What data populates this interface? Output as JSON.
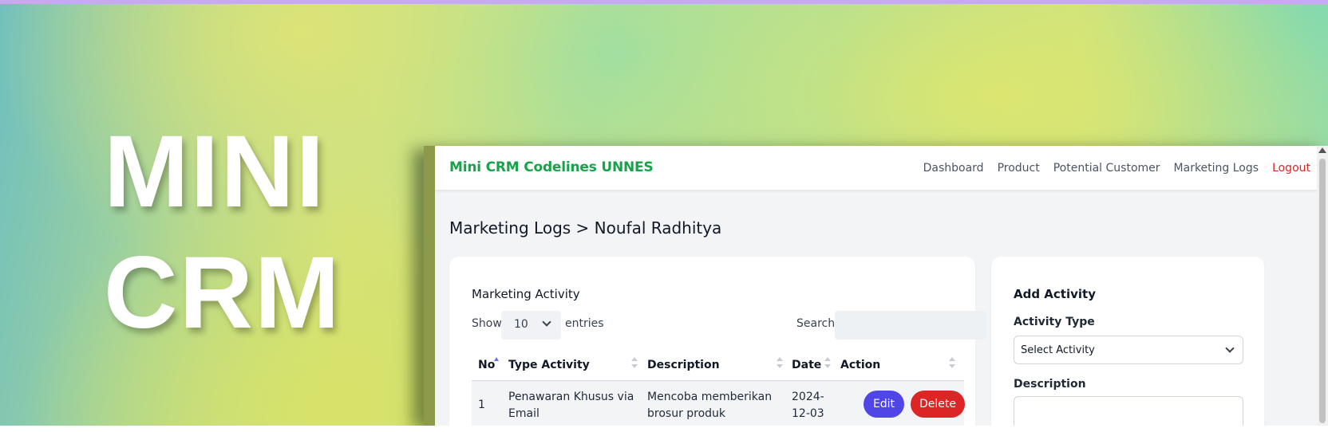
{
  "hero": {
    "line1": "MINI",
    "line2": "CRM"
  },
  "navbar": {
    "brand": "Mini CRM Codelines UNNES",
    "links": [
      "Dashboard",
      "Product",
      "Potential Customer",
      "Marketing Logs"
    ],
    "logout": "Logout"
  },
  "page": {
    "title": "Marketing Logs > Noufal Radhitya"
  },
  "activity_table": {
    "card_title": "Marketing Activity",
    "show_label": "Show",
    "entries_value": "10",
    "entries_label": "entries",
    "search_label": "Search:",
    "search_value": "",
    "headers": [
      "No",
      "Type Activity",
      "Description",
      "Date",
      "Action"
    ],
    "rows": [
      {
        "no": "1",
        "type_line1": "Penawaran Khusus via",
        "type_line2": "Email",
        "desc_line1": "Mencoba memberikan",
        "desc_line2": "brosur produk",
        "date_line1": "2024-",
        "date_line2": "12-03",
        "edit": "Edit",
        "delete": "Delete"
      }
    ]
  },
  "add_activity": {
    "title": "Add Activity",
    "type_label": "Activity Type",
    "type_value": "Select Activity",
    "description_label": "Description"
  },
  "colors": {
    "brand": "#16a34a",
    "logout": "#dc2626",
    "edit": "#4f46e5",
    "delete": "#dc2626"
  }
}
